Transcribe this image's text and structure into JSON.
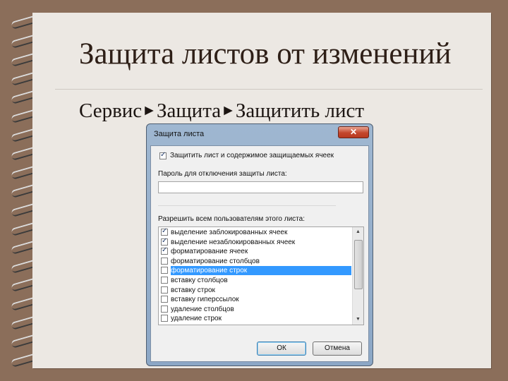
{
  "slide": {
    "title": "Защита листов от изменений",
    "path": {
      "step1": "Сервис",
      "step2": "Защита",
      "step3": "Защитить лист",
      "separator": "►"
    }
  },
  "dialog": {
    "title": "Защита листа",
    "close_label": "✕",
    "protect_checkbox_label": "Защитить лист и содержимое защищаемых ячеек",
    "protect_checked": true,
    "password_label": "Пароль для отключения защиты листа:",
    "password_value": "",
    "allow_label": "Разрешить всем пользователям этого листа:",
    "permissions": [
      {
        "label": "выделение заблокированных ячеек",
        "checked": true,
        "selected": false
      },
      {
        "label": "выделение незаблокированных ячеек",
        "checked": true,
        "selected": false
      },
      {
        "label": "форматирование ячеек",
        "checked": true,
        "selected": false
      },
      {
        "label": "форматирование столбцов",
        "checked": false,
        "selected": false
      },
      {
        "label": "форматирование строк",
        "checked": false,
        "selected": true
      },
      {
        "label": "вставку столбцов",
        "checked": false,
        "selected": false
      },
      {
        "label": "вставку строк",
        "checked": false,
        "selected": false
      },
      {
        "label": "вставку гиперссылок",
        "checked": false,
        "selected": false
      },
      {
        "label": "удаление столбцов",
        "checked": false,
        "selected": false
      },
      {
        "label": "удаление строк",
        "checked": false,
        "selected": false
      }
    ],
    "ok_label": "ОК",
    "cancel_label": "Отмена"
  }
}
